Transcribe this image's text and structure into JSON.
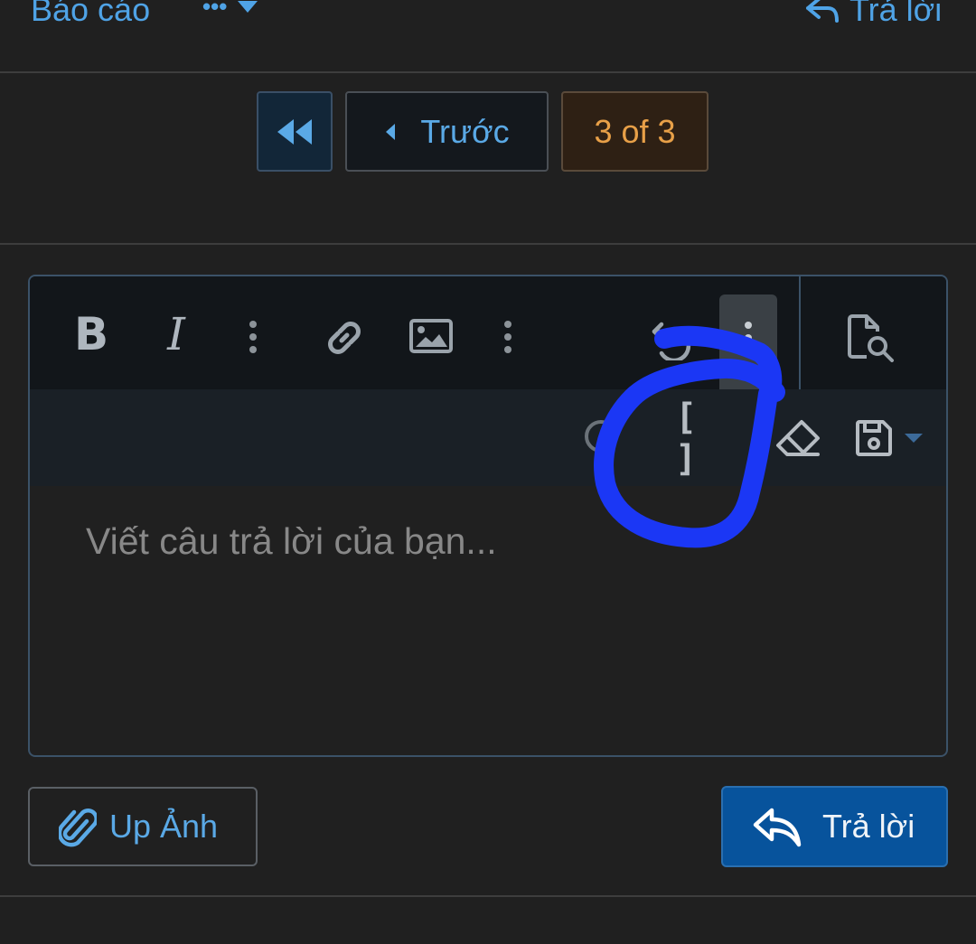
{
  "header": {
    "report_label": "Báo cáo",
    "more_label": "•••",
    "reply_label": "Trả lời"
  },
  "pagination": {
    "first_icon": "double-chevron-left-icon",
    "prev_label": "Trước",
    "current_label": "3 of 3"
  },
  "editor": {
    "toolbar": {
      "bold_label": "B",
      "italic_label": "I",
      "bracket_label": "[ ]",
      "icons": [
        "link-icon",
        "image-icon",
        "undo-icon",
        "more-vertical-icon",
        "preview-icon",
        "eraser-icon",
        "save-icon",
        "chevron-down-icon"
      ]
    },
    "placeholder": "Viết câu trả lời của bạn..."
  },
  "actions": {
    "upload_label": "Up Ảnh",
    "submit_label": "Trả lời"
  },
  "colors": {
    "accent": "#4fa3e6",
    "current_page": "#e8a048",
    "primary_button": "#07539c",
    "annotation": "#1b37f5"
  }
}
